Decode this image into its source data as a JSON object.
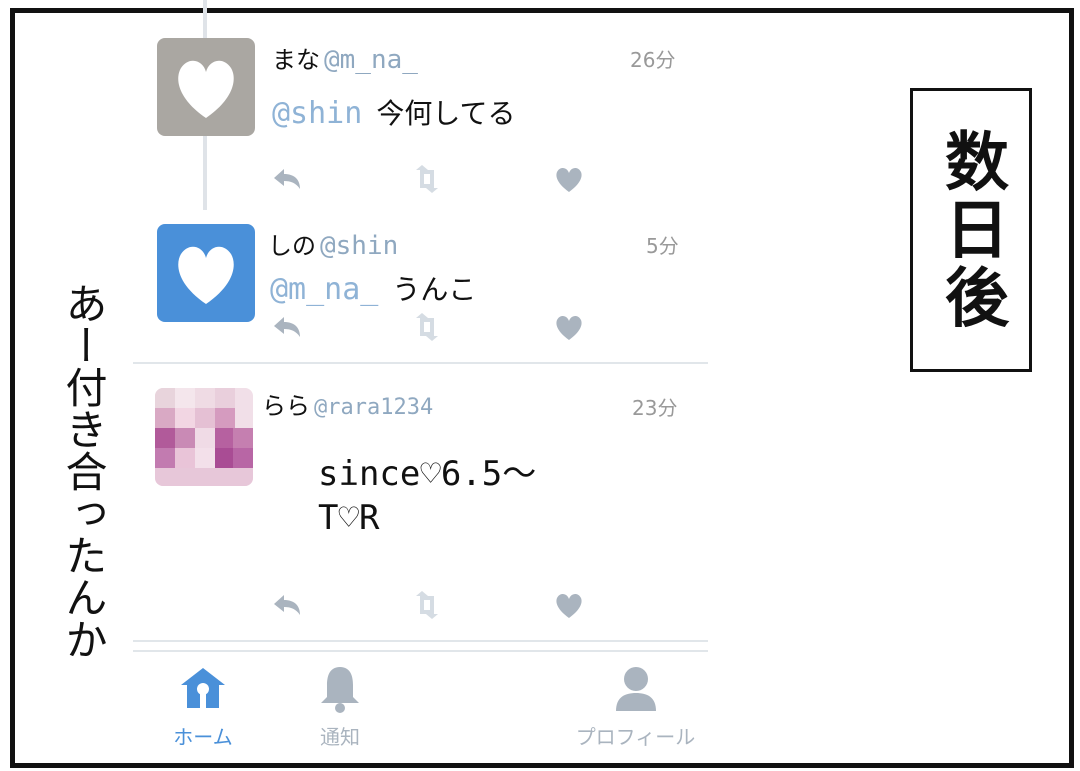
{
  "tweets": [
    {
      "name": "まな",
      "handle": "@m_na_",
      "time": "26分",
      "mention": "@shin",
      "text": "今何してる"
    },
    {
      "name": "しの",
      "handle": "@shin",
      "time": "5分",
      "mention": "@m_na_",
      "text": "うんこ"
    },
    {
      "name": "らら",
      "handle": "@rara1234",
      "time": "23分",
      "line1": "since♡6.5～",
      "line2": "T♡R"
    }
  ],
  "tabs": [
    {
      "label": "ホーム",
      "icon": "home-icon",
      "active": true
    },
    {
      "label": "通知",
      "icon": "bell-icon",
      "active": false
    },
    {
      "label": "プロフィール",
      "icon": "profile-icon",
      "active": false
    }
  ],
  "side_text": "あー付き合ったんか",
  "box_text": "数日後",
  "colors": {
    "accent": "#4a90d9",
    "handle": "#8fa8c0",
    "icon": "#aab4bf",
    "avatar_blue": "#4a90d9",
    "avatar_gray": "#aaa7a2"
  }
}
